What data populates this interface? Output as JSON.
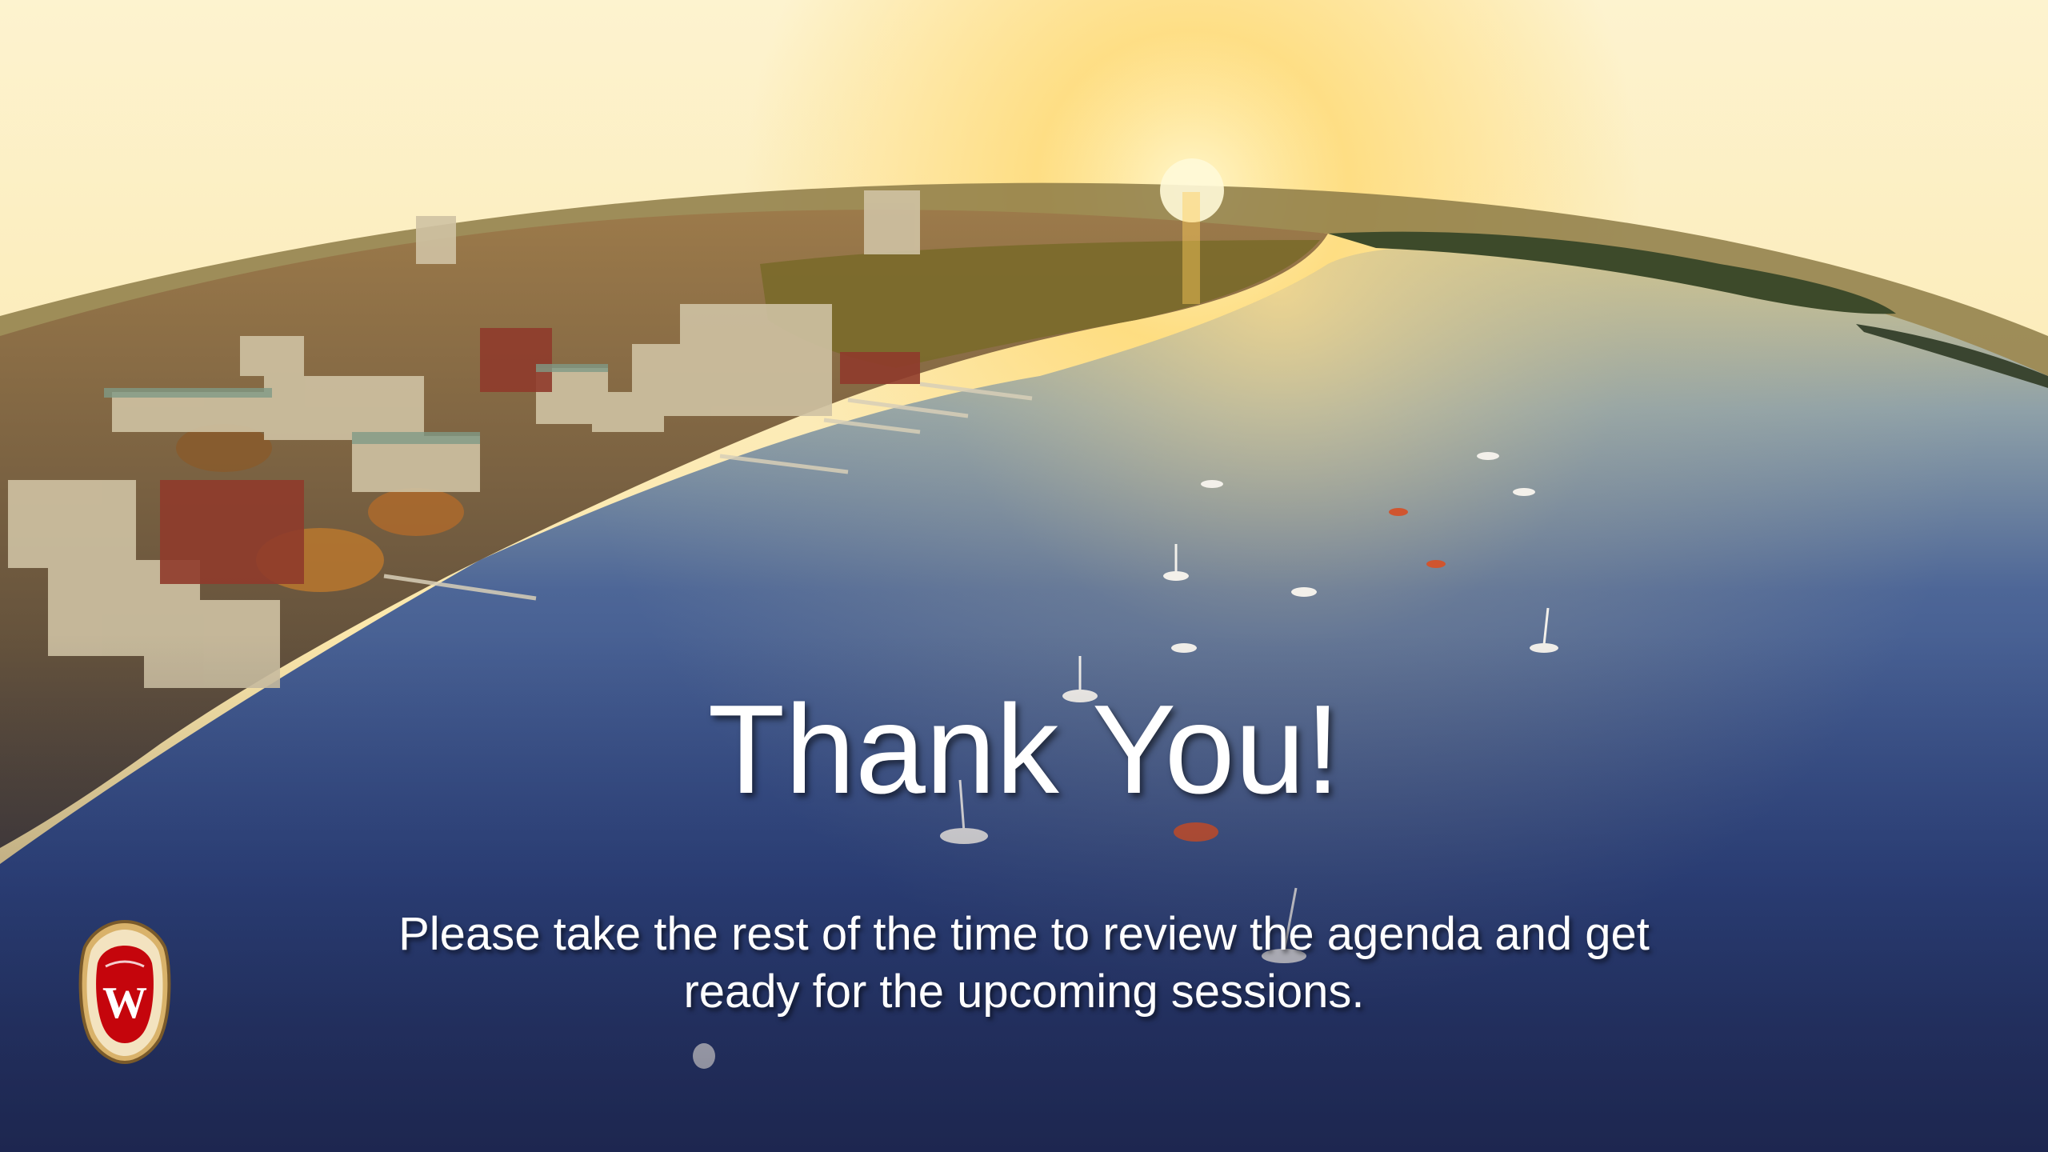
{
  "slide": {
    "title": "Thank You!",
    "subtitle_line1": "Please take the rest of the time to review the agenda and get",
    "subtitle_line2": "ready for the upcoming sessions."
  },
  "crest": {
    "letter": "W",
    "icon": "uw-crest-icon"
  },
  "colors": {
    "sky": "#fbe9b0",
    "sun": "#ffd36a",
    "water": "#2f4a86",
    "water_deep": "#1e2a55",
    "crest_red": "#c5050c",
    "crest_gold": "#d9b26a"
  }
}
